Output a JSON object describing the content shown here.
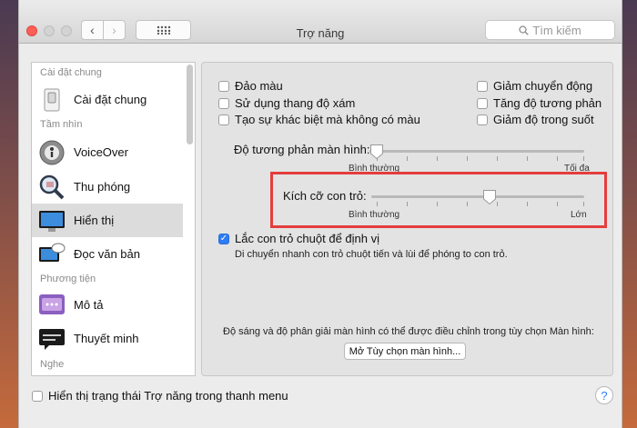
{
  "window": {
    "title": "Trợ năng"
  },
  "search": {
    "placeholder": "Tìm kiếm"
  },
  "sidebar": {
    "sections": [
      "Cài đặt chung",
      "Tầm nhìn",
      "Phương tiện",
      "Nghe"
    ],
    "items": [
      {
        "label": "Cài đặt chung",
        "icon": "switch-icon"
      },
      {
        "label": "VoiceOver",
        "icon": "voiceover-icon"
      },
      {
        "label": "Thu phóng",
        "icon": "zoom-magnifier-icon"
      },
      {
        "label": "Hiển thị",
        "icon": "display-monitor-icon",
        "selected": true
      },
      {
        "label": "Đọc văn bản",
        "icon": "speech-bubble-icon"
      },
      {
        "label": "Mô tả",
        "icon": "description-icon"
      },
      {
        "label": "Thuyết minh",
        "icon": "captions-icon"
      }
    ]
  },
  "options": {
    "invert": "Đảo màu",
    "grayscale": "Sử dụng thang độ xám",
    "differentiate": "Tạo sự khác biệt mà không có màu",
    "reduce_motion": "Giảm chuyển động",
    "increase_contrast": "Tăng độ tương phản",
    "reduce_transparency": "Giảm độ trong suốt"
  },
  "contrast_slider": {
    "label": "Độ tương phản màn hình:",
    "min_label": "Bình thường",
    "max_label": "Tối đa",
    "value_fraction": 0.0
  },
  "cursor_slider": {
    "label": "Kích cỡ con trỏ:",
    "min_label": "Bình thường",
    "max_label": "Lớn",
    "value_fraction": 0.56
  },
  "shake": {
    "label": "Lắc con trỏ chuột để định vị",
    "checked": true,
    "description": "Di chuyển nhanh con trỏ chuột tiến và lùi để phóng to con trỏ."
  },
  "display_note": "Độ sáng và độ phân giải màn hình có thể được điều chỉnh trong tùy chọn Màn hình:",
  "open_display_button": "Mở Tùy chọn màn hình...",
  "menu_status": {
    "label": "Hiển thị trạng thái Trợ năng trong thanh menu",
    "checked": false
  },
  "help_label": "?",
  "colors": {
    "accent": "#2e7cf6",
    "highlight": "#e53d3d",
    "close": "#fc5f57"
  }
}
